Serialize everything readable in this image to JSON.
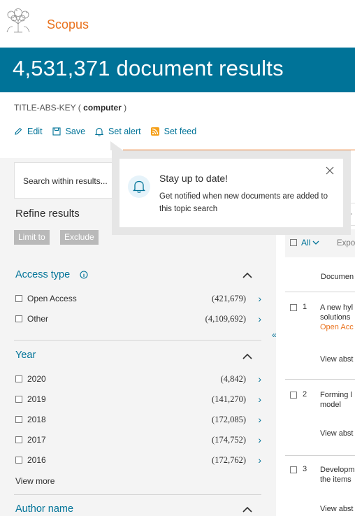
{
  "brand": {
    "name": "Scopus",
    "logo_icon": "elsevier-tree-logo"
  },
  "results": {
    "title": "4,531,371 document results"
  },
  "query": {
    "prefix": "TITLE-ABS-KEY ( ",
    "term": "computer",
    "suffix": " )"
  },
  "actions": {
    "edit": "Edit",
    "save": "Save",
    "set_alert": "Set alert",
    "set_feed": "Set feed"
  },
  "refine": {
    "search_placeholder": "Search within results...",
    "title": "Refine results",
    "limit_to": "Limit to",
    "exclude": "Exclude"
  },
  "facets": {
    "access": {
      "title": "Access type",
      "items": [
        {
          "label": "Open Access",
          "count": "(421,679)"
        },
        {
          "label": "Other",
          "count": "(4,109,692)"
        }
      ]
    },
    "year": {
      "title": "Year",
      "items": [
        {
          "label": "2020",
          "count": "(4,842)"
        },
        {
          "label": "2019",
          "count": "(141,270)"
        },
        {
          "label": "2018",
          "count": "(172,085)"
        },
        {
          "label": "2017",
          "count": "(174,752)"
        },
        {
          "label": "2016",
          "count": "(172,762)"
        }
      ],
      "view_more": "View more"
    },
    "author": {
      "title": "Author name"
    }
  },
  "results_list": {
    "sort_partial": "ar",
    "all": "All",
    "export": "Expor",
    "col_document": "Documen",
    "items": [
      {
        "num": "1",
        "line1": "A new hyl",
        "line2": "solutions",
        "line3": "Open Acc",
        "view": "View abst"
      },
      {
        "num": "2",
        "line1": "Forming l",
        "line2": "model",
        "view": "View abst"
      },
      {
        "num": "3",
        "line1": "Developm",
        "line2": "the items",
        "view": "View abst"
      }
    ]
  },
  "popup": {
    "title": "Stay up to date!",
    "text": "Get notified when new documents are added to this topic search"
  },
  "colors": {
    "accent": "#007398",
    "brand_orange": "#e9711c",
    "panel_bg": "#f4f4f4"
  }
}
